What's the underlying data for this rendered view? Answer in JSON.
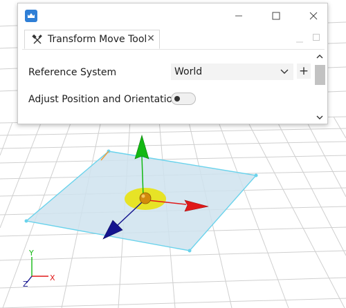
{
  "window": {
    "app_icon": "app-logo-icon",
    "minimize": "–",
    "maximize": "□",
    "close": "✕"
  },
  "tab": {
    "title": "Transform Move Tool",
    "icon": "tools-icon",
    "close": "✕"
  },
  "form": {
    "reference_label": "Reference System",
    "reference_value": "World",
    "add_label": "+",
    "adjust_label": "Adjust Position and Orientation",
    "adjust_enabled": false
  },
  "axes": {
    "x": "X",
    "y": "Y",
    "z": "Z"
  },
  "colors": {
    "x_axis": "#e01919",
    "y_axis": "#13b813",
    "z_axis": "#14148f",
    "plane_fill": "#cfe3ee",
    "plane_edge": "#6ad3ec",
    "center_ring": "#e8e31a",
    "center_sphere": "#d28a0c",
    "grid": "#c9c9c9"
  }
}
